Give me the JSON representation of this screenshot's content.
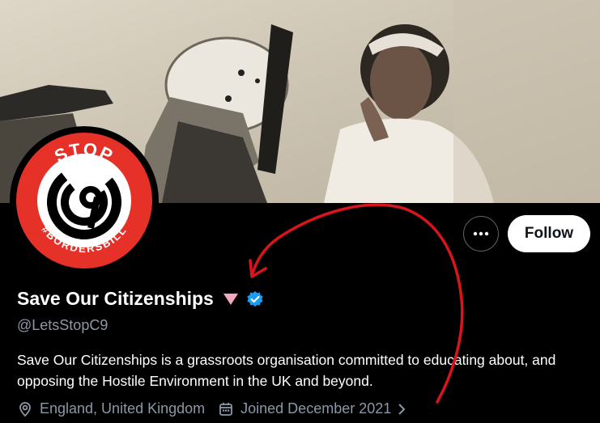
{
  "profile": {
    "display_name": "Save Our Citizenships",
    "handle": "@LetsStopC9",
    "bio": "Save Our Citizenships is a grassroots organisation committed to educating about, and opposing the Hostile Environment in the UK and beyond.",
    "location": "England, United Kingdom",
    "joined": "Joined December 2021"
  },
  "actions": {
    "follow_label": "Follow",
    "more_icon": "more-options-icon"
  },
  "avatar": {
    "top_text": "STOP",
    "logo_text": "C9",
    "ring_text": "#BORDERSBILL",
    "colors": {
      "ring": "#e53128",
      "inner": "#ffffff",
      "logo": "#000000"
    }
  },
  "icons": {
    "verified": "verified-badge-icon",
    "location": "location-pin-icon",
    "calendar": "calendar-icon",
    "chevron": "chevron-right-icon",
    "triangle": "pink-triangle-icon"
  },
  "colors": {
    "background": "#000000",
    "text_primary": "#ffffff",
    "text_secondary": "#8b98a5",
    "verified": "#1d9bf0",
    "triangle": "#f4a7c0",
    "annotation": "#d8141c"
  }
}
